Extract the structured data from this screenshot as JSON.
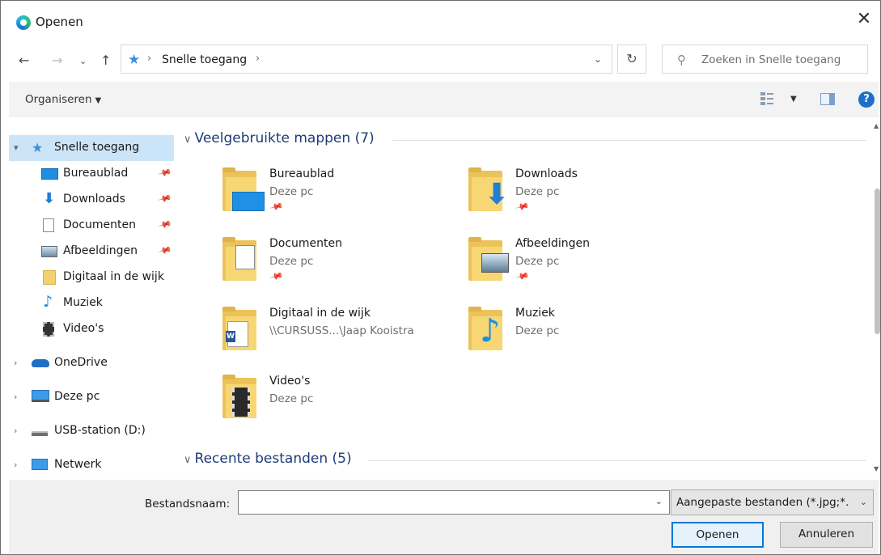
{
  "window": {
    "title": "Openen",
    "close_symbol": "✕"
  },
  "address": {
    "location": "Snelle toegang",
    "separator": "›",
    "search_placeholder": "Zoeken in Snelle toegang"
  },
  "toolbar": {
    "organise_label": "Organiseren"
  },
  "sidebar": {
    "quick_access": "Snelle toegang",
    "pinned": [
      {
        "label": "Bureaublad",
        "icon": "desktop-icon"
      },
      {
        "label": "Downloads",
        "icon": "download-arrow-icon"
      },
      {
        "label": "Documenten",
        "icon": "document-icon"
      },
      {
        "label": "Afbeeldingen",
        "icon": "pictures-icon"
      }
    ],
    "recent": [
      {
        "label": "Digitaal in de wijk",
        "icon": "folder-icon"
      },
      {
        "label": "Muziek",
        "icon": "music-note-icon"
      },
      {
        "label": "Video's",
        "icon": "film-icon"
      }
    ],
    "roots": [
      {
        "label": "OneDrive",
        "icon": "cloud-icon"
      },
      {
        "label": "Deze pc",
        "icon": "computer-icon"
      },
      {
        "label": "USB-station (D:)",
        "icon": "drive-icon"
      },
      {
        "label": "Netwerk",
        "icon": "network-icon"
      }
    ]
  },
  "content": {
    "group1_title": "Veelgebruikte mappen (7)",
    "group2_title": "Recente bestanden (5)",
    "folders": [
      {
        "name": "Bureaublad",
        "location": "Deze pc",
        "pinned": true,
        "overlay": "desktop"
      },
      {
        "name": "Downloads",
        "location": "Deze pc",
        "pinned": true,
        "overlay": "downloads"
      },
      {
        "name": "Documenten",
        "location": "Deze pc",
        "pinned": true,
        "overlay": "documents"
      },
      {
        "name": "Afbeeldingen",
        "location": "Deze pc",
        "pinned": true,
        "overlay": "pictures"
      },
      {
        "name": "Digitaal in de wijk",
        "location": "\\\\CURSUSS...\\Jaap Kooistra",
        "pinned": false,
        "overlay": "word"
      },
      {
        "name": "Muziek",
        "location": "Deze pc",
        "pinned": false,
        "overlay": "music"
      },
      {
        "name": "Video's",
        "location": "Deze pc",
        "pinned": false,
        "overlay": "video"
      }
    ]
  },
  "footer": {
    "filename_label": "Bestandsnaam:",
    "filename_value": "",
    "filter_value": "Aangepaste bestanden (*.jpg;*.",
    "open_label": "Openen",
    "cancel_label": "Annuleren"
  },
  "colors": {
    "selection": "#cce4f7",
    "accent": "#0078d7",
    "group_heading": "#1e3c78"
  }
}
